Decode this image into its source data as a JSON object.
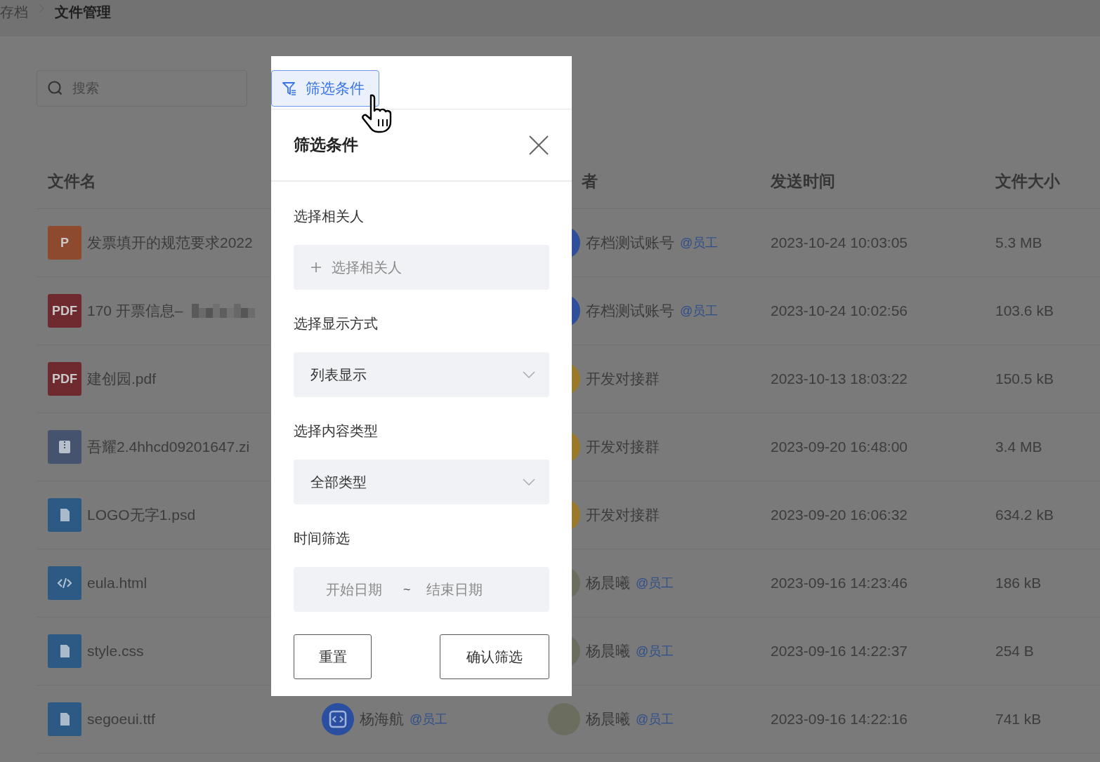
{
  "breadcrumb": [
    {
      "label": "存档",
      "current": false
    },
    {
      "label": "文件管理",
      "current": true
    }
  ],
  "search": {
    "placeholder": "搜索"
  },
  "table": {
    "columns": [
      "文件名",
      "者",
      "发送时间",
      "文件大小"
    ],
    "rows": [
      {
        "kind": "ppt",
        "badge": "P",
        "name": "发票填开的规范要求2022",
        "receiver": {
          "kind": "account",
          "name": "存档测试账号",
          "tag": "@员工"
        },
        "time": "2023-10-24 10:03:05",
        "size": "5.3 MB"
      },
      {
        "kind": "pdf",
        "badge": "PDF",
        "name": "170 开票信息–",
        "redacted": true,
        "receiver": {
          "kind": "account",
          "name": "存档测试账号",
          "tag": "@员工"
        },
        "time": "2023-10-24 10:02:56",
        "size": "103.6 kB"
      },
      {
        "kind": "pdf",
        "badge": "PDF",
        "name": "建创园.pdf",
        "receiver": {
          "kind": "group",
          "name": "开发对接群"
        },
        "time": "2023-10-13 18:03:22",
        "size": "150.5 kB"
      },
      {
        "kind": "zip",
        "name": "吾耀2.4hhcd09201647.zi",
        "receiver": {
          "kind": "group",
          "name": "开发对接群"
        },
        "time": "2023-09-20 16:48:00",
        "size": "3.4 MB"
      },
      {
        "kind": "file",
        "name": "LOGO无字1.psd",
        "receiver": {
          "kind": "group",
          "name": "开发对接群"
        },
        "time": "2023-09-20 16:06:32",
        "size": "634.2 kB"
      },
      {
        "kind": "code",
        "name": "eula.html",
        "receiver": {
          "kind": "photo",
          "name": "杨晨曦",
          "tag": "@员工"
        },
        "time": "2023-09-16 14:23:46",
        "size": "186 kB"
      },
      {
        "kind": "file",
        "name": "style.css",
        "receiver": {
          "kind": "photo",
          "name": "杨晨曦",
          "tag": "@员工"
        },
        "time": "2023-09-16 14:22:37",
        "size": "254 B"
      },
      {
        "kind": "file",
        "name": "segoeui.ttf",
        "sender": {
          "kind": "code",
          "name": "杨海航",
          "tag": "@员工"
        },
        "receiver": {
          "kind": "photo",
          "name": "杨晨曦",
          "tag": "@员工"
        },
        "time": "2023-09-16 14:22:16",
        "size": "741 kB"
      }
    ]
  },
  "filter_button": {
    "label": "筛选条件"
  },
  "panel": {
    "title": "筛选条件",
    "sections": [
      {
        "label": "选择相关人",
        "kind": "picker",
        "text": "选择相关人"
      },
      {
        "label": "选择显示方式",
        "kind": "select",
        "value": "列表显示"
      },
      {
        "label": "选择内容类型",
        "kind": "select",
        "value": "全部类型"
      },
      {
        "label": "时间筛选",
        "kind": "daterange",
        "start_placeholder": "开始日期",
        "separator": "~",
        "end_placeholder": "结束日期"
      }
    ],
    "buttons": [
      {
        "label": "重置",
        "kind": "reset"
      },
      {
        "label": "确认筛选",
        "kind": "confirm"
      }
    ]
  }
}
